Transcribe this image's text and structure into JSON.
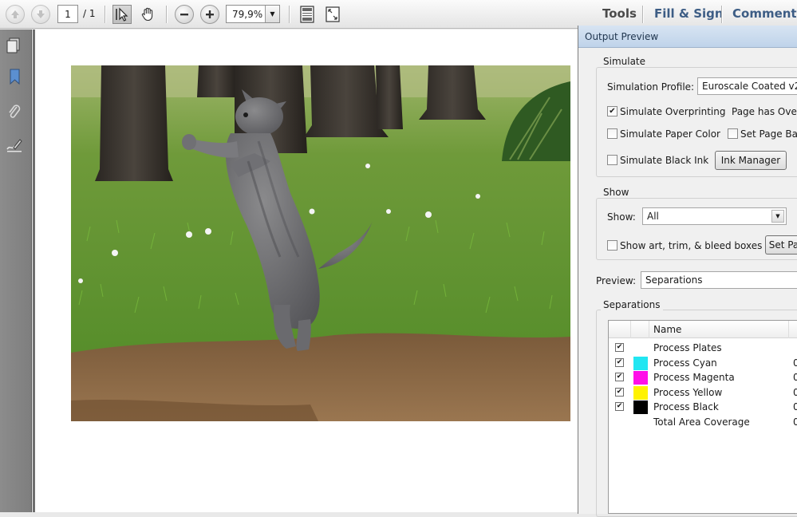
{
  "toolbar": {
    "page_current": "1",
    "page_total": "/ 1",
    "zoom_value": "79,9%",
    "tools_label": "Tools",
    "fill_sign_label": "Fill & Sign",
    "comment_label": "Comment",
    "link_color": "#3d5d85"
  },
  "panel": {
    "title": "Output Preview",
    "simulate": {
      "heading": "Simulate",
      "profile_label": "Simulation Profile:",
      "profile_value": "Euroscale Coated v2",
      "overprinting_label": "Simulate Overprinting",
      "overprinting_checked": true,
      "page_overprint_label": "Page has Overpr",
      "paper_color_label": "Simulate Paper Color",
      "page_background_label": "Set Page Back",
      "black_ink_label": "Simulate Black Ink",
      "ink_manager_label": "Ink Manager"
    },
    "show": {
      "heading": "Show",
      "show_label": "Show:",
      "show_value": "All",
      "boxes_label": "Show art, trim, & bleed boxes",
      "set_button_label": "Set Pa"
    },
    "preview": {
      "label": "Preview:",
      "value": "Separations"
    },
    "separations": {
      "heading": "Separations",
      "column_name": "Name",
      "rows": [
        {
          "name": "Process Plates",
          "checked": true,
          "swatch": "",
          "pct": ""
        },
        {
          "name": "Process Cyan",
          "checked": true,
          "swatch": "#22e6f2",
          "pct": "0"
        },
        {
          "name": "Process Magenta",
          "checked": true,
          "swatch": "#ff10e8",
          "pct": "0"
        },
        {
          "name": "Process Yellow",
          "checked": true,
          "swatch": "#fff200",
          "pct": "0"
        },
        {
          "name": "Process Black",
          "checked": true,
          "swatch": "#000000",
          "pct": "0"
        },
        {
          "name": "Total Area Coverage",
          "checked": false,
          "swatch": "",
          "pct": "0"
        }
      ]
    }
  }
}
